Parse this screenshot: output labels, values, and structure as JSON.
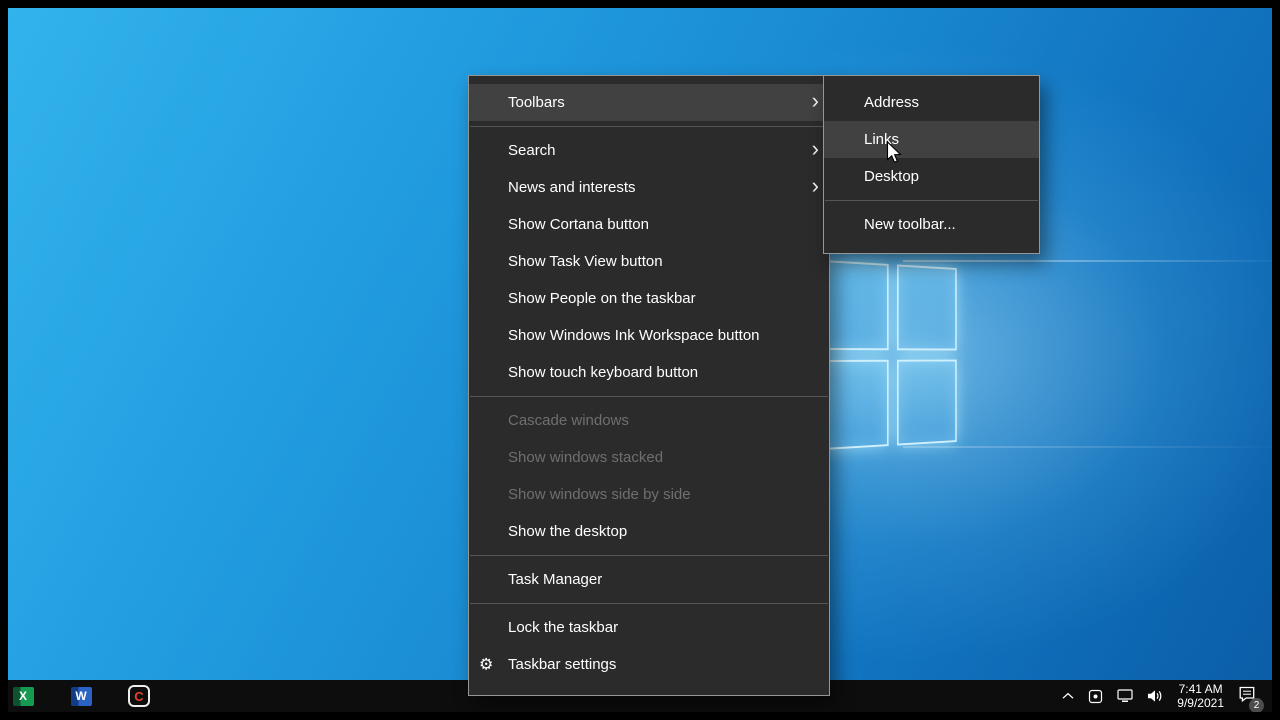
{
  "icons": {
    "submenu_chevron": "›",
    "gear": "⚙"
  },
  "colors": {
    "menu_bg": "#2b2b2b",
    "menu_highlight": "#414141",
    "menu_border": "#969696",
    "taskbar_bg": "#0d0d0d",
    "desktop_blue": "#1a8cd4"
  },
  "context_menu": {
    "items": [
      {
        "label": "Toolbars",
        "has_submenu": true,
        "highlighted": true
      },
      {
        "label": "Search",
        "has_submenu": true
      },
      {
        "label": "News and interests",
        "has_submenu": true
      },
      {
        "label": "Show Cortana button"
      },
      {
        "label": "Show Task View button"
      },
      {
        "label": "Show People on the taskbar"
      },
      {
        "label": "Show Windows Ink Workspace button"
      },
      {
        "label": "Show touch keyboard button"
      },
      {
        "label": "Cascade windows",
        "disabled": true
      },
      {
        "label": "Show windows stacked",
        "disabled": true
      },
      {
        "label": "Show windows side by side",
        "disabled": true
      },
      {
        "label": "Show the desktop"
      },
      {
        "label": "Task Manager"
      },
      {
        "label": "Lock the taskbar"
      },
      {
        "label": "Taskbar settings",
        "icon": "gear"
      }
    ]
  },
  "submenu": {
    "items": [
      {
        "label": "Address"
      },
      {
        "label": "Links",
        "highlighted": true
      },
      {
        "label": "Desktop"
      },
      {
        "label": "New toolbar..."
      }
    ]
  },
  "taskbar": {
    "apps": [
      {
        "name": "Excel",
        "letter": "X"
      },
      {
        "name": "Word",
        "letter": "W"
      },
      {
        "name": "Camtasia",
        "letter": "C"
      }
    ],
    "tray": {
      "time": "7:41 AM",
      "date": "9/9/2021",
      "badge": "2"
    }
  }
}
